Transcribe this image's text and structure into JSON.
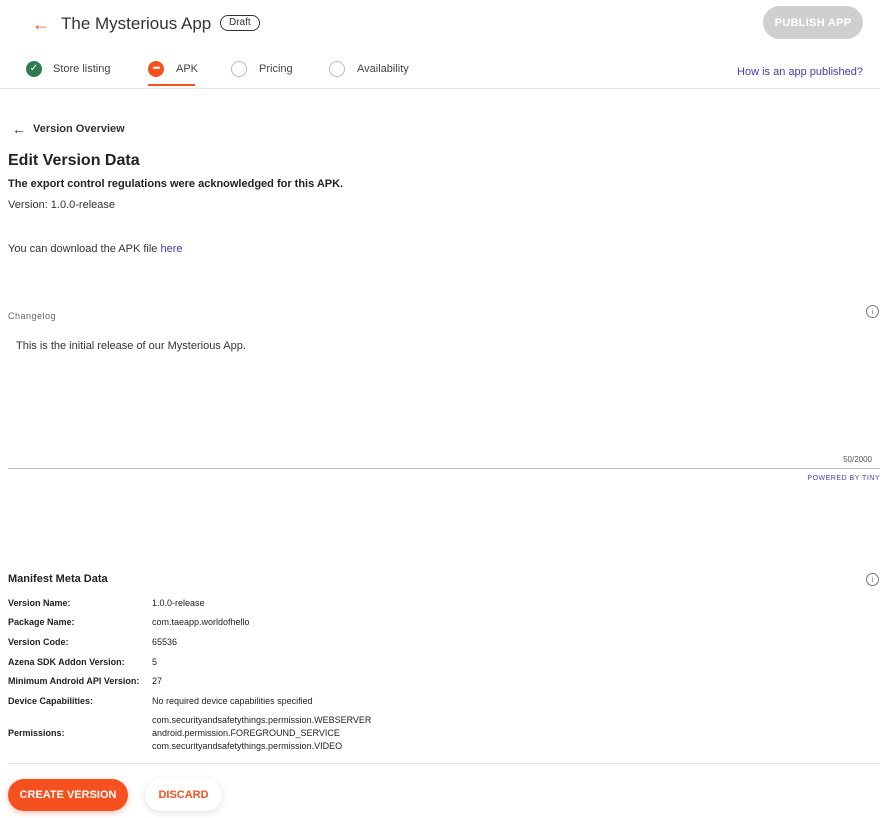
{
  "header": {
    "back_icon": "arrow-left-icon",
    "title": "The Mysterious App",
    "badge": "Draft",
    "publish_label": "PUBLISH APP"
  },
  "steps": [
    {
      "label": "Store listing",
      "state": "done"
    },
    {
      "label": "APK",
      "state": "active"
    },
    {
      "label": "Pricing",
      "state": "empty"
    },
    {
      "label": "Availability",
      "state": "empty"
    }
  ],
  "help_link": "How is an app published?",
  "nav": {
    "back_label": "Version Overview"
  },
  "edit": {
    "title": "Edit Version Data",
    "ack": "The export control regulations were acknowledged for this APK.",
    "version": "Version: 1.0.0-release",
    "download_prefix": "You can download the APK file ",
    "download_link": "here"
  },
  "changelog": {
    "label": "Changelog",
    "text": "This is the initial release of our Mysterious App.",
    "counter": "50/2000",
    "powered_by": "POWERED BY TINY"
  },
  "manifest": {
    "title": "Manifest Meta Data",
    "rows": [
      {
        "label": "Version Name:",
        "value": "1.0.0-release"
      },
      {
        "label": "Package Name:",
        "value": "com.taeapp.worldofhello"
      },
      {
        "label": "Version Code:",
        "value": "65536"
      },
      {
        "label": "Azena SDK Addon Version:",
        "value": "5"
      },
      {
        "label": "Minimum Android API Version:",
        "value": "27"
      },
      {
        "label": "Device Capabilities:",
        "value": "No required device capabilities specified"
      }
    ],
    "permissions_label": "Permissions:",
    "permissions": [
      "com.securityandsafetythings.permission.WEBSERVER",
      "android.permission.FOREGROUND_SERVICE",
      "com.securityandsafetythings.permission.VIDEO"
    ]
  },
  "actions": {
    "create_label": "CREATE VERSION",
    "discard_label": "DISCARD"
  },
  "colors": {
    "accent": "#f4511e",
    "done": "#2e7d4f",
    "link": "#4a3ab8"
  }
}
